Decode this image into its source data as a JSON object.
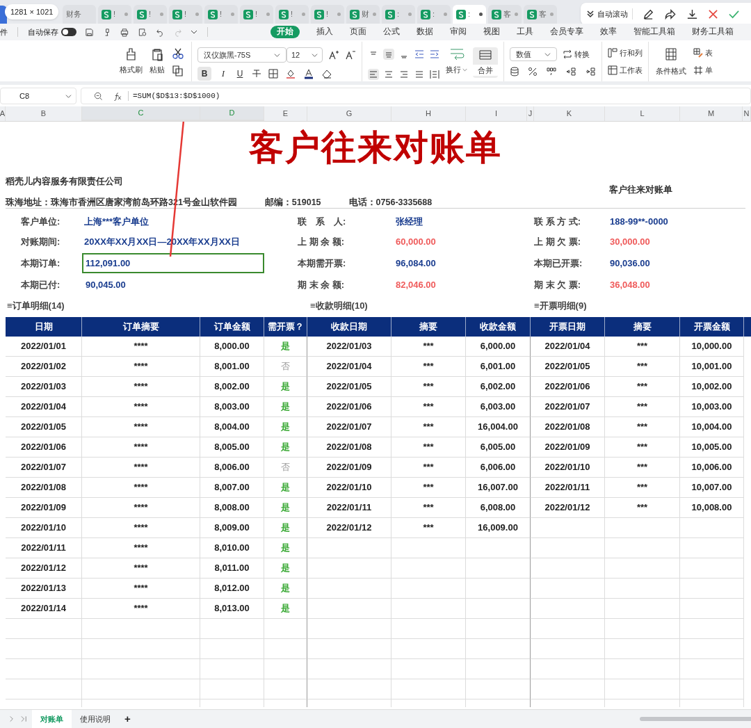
{
  "browser_tabs": {
    "size_tooltip": "1281 × 1021",
    "tabs": [
      {
        "label": "财务",
        "kind": "plain",
        "selected": false
      },
      {
        "label": "!",
        "kind": "sheet",
        "selected": false
      },
      {
        "label": "!",
        "kind": "sheet",
        "selected": false
      },
      {
        "label": "!",
        "kind": "sheet",
        "selected": false
      },
      {
        "label": "!",
        "kind": "sheet",
        "selected": false
      },
      {
        "label": "!",
        "kind": "sheet",
        "selected": false
      },
      {
        "label": "!",
        "kind": "sheet",
        "selected": false
      },
      {
        "label": "!",
        "kind": "sheet",
        "selected": false
      },
      {
        "label": "财",
        "kind": "sheet",
        "selected": false
      },
      {
        "label": ":",
        "kind": "sheet",
        "selected": false
      },
      {
        "label": ":",
        "kind": "sheet",
        "selected": false
      },
      {
        "label": ":",
        "kind": "sheet",
        "selected": true
      },
      {
        "label": "客",
        "kind": "sheet",
        "selected": false
      },
      {
        "label": "客",
        "kind": "sheet",
        "selected": false
      }
    ]
  },
  "float_toolbar": {
    "auto_scroll": "自动滚动"
  },
  "menu": {
    "file": "件",
    "autosave": "自动保存",
    "autosave_on": false,
    "tabs": [
      {
        "label": "开始",
        "selected": true
      },
      {
        "label": "插入",
        "selected": false
      },
      {
        "label": "页面",
        "selected": false
      },
      {
        "label": "公式",
        "selected": false
      },
      {
        "label": "数据",
        "selected": false
      },
      {
        "label": "审阅",
        "selected": false
      },
      {
        "label": "视图",
        "selected": false
      },
      {
        "label": "工具",
        "selected": false
      },
      {
        "label": "会员专享",
        "selected": false
      },
      {
        "label": "效率",
        "selected": false
      },
      {
        "label": "智能工具箱",
        "selected": false
      },
      {
        "label": "财务工具箱",
        "selected": false
      }
    ]
  },
  "ribbon": {
    "format_painter": "格式刷",
    "paste": "粘贴",
    "font": "汉仪旗黑-75S",
    "size": "12",
    "bold": "B",
    "italic": "I",
    "underline": "U",
    "wrap": "换行",
    "merge": "合并",
    "number_format": "数值",
    "convert": "转换",
    "rows_cols": "行和列",
    "worksheet": "工作表",
    "conditional": "条件格式",
    "table_cut": "表",
    "cell_cut": "单"
  },
  "formula_bar": {
    "cell": "C8",
    "formula": "=SUM($D$13:$D$1000)"
  },
  "column_headers": [
    {
      "label": "A",
      "selected": false
    },
    {
      "label": "B",
      "selected": false
    },
    {
      "label": "C",
      "selected": true
    },
    {
      "label": "D",
      "selected": true
    },
    {
      "label": "E",
      "selected": false
    },
    {
      "label": "G",
      "selected": false
    },
    {
      "label": "H",
      "selected": false
    },
    {
      "label": "I",
      "selected": false
    },
    {
      "label": "J",
      "selected": false
    },
    {
      "label": "K",
      "selected": false
    },
    {
      "label": "L",
      "selected": false
    },
    {
      "label": "M",
      "selected": false
    },
    {
      "label": "N",
      "selected": false
    }
  ],
  "sheet": {
    "title": "客户往来对账单",
    "company": "稻壳儿内容服务有限责任公司",
    "address": "珠海地址：珠海市香洲区唐家湾前岛环路321号金山软件园",
    "postcode": "邮编：519015",
    "phone": "电话：0756-3335688",
    "doc_name": "客户往来对账单",
    "info": [
      [
        {
          "label": "客户单位:",
          "value": "上海***客户单位",
          "color": "#1a3d8f"
        },
        {
          "label": "联　系　人:",
          "value": "张经理",
          "color": "#1a3d8f"
        },
        {
          "label": "联 系 方 式:",
          "value": "188-99**-0000",
          "color": "#1a3d8f"
        }
      ],
      [
        {
          "label": "对账期间:",
          "value": "20XX年XX月XX日—20XX年XX月XX日",
          "color": "#1a3d8f"
        },
        {
          "label": "上 期 余 额:",
          "value": "60,000.00",
          "color": "#ef5b5b"
        },
        {
          "label": "上 期 欠 票:",
          "value": "30,000.00",
          "color": "#ef5b5b"
        }
      ],
      [
        {
          "label": "本期订单:",
          "value": "112,091.00",
          "color": "#1a3d8f",
          "selected": true
        },
        {
          "label": "本期需开票:",
          "value": "96,084.00",
          "color": "#1a3d8f"
        },
        {
          "label": "本期已开票:",
          "value": "90,036.00",
          "color": "#1a3d8f"
        }
      ],
      [
        {
          "label": "本期已付:",
          "value": "90,045.00",
          "color": "#1a3d8f",
          "selected": false
        },
        {
          "label": "期 末 余 额:",
          "value": "82,046.00",
          "color": "#ef5b5b"
        },
        {
          "label": "期 末 欠 票:",
          "value": "36,048.00",
          "color": "#ef5b5b"
        }
      ]
    ],
    "sections": [
      "≡订单明细(14)",
      "≡收款明细(10)",
      "≡开票明细(9)"
    ],
    "columns": [
      "日期",
      "订单摘要",
      "订单金额",
      "需开票？",
      "收款日期",
      "摘要",
      "收款金额",
      "开票日期",
      "摘要",
      "开票金额"
    ],
    "orders": [
      {
        "date": "2022/01/01",
        "summary": "****",
        "amount": "8,000.00",
        "invoice": "是",
        "needs_invoice": true
      },
      {
        "date": "2022/01/02",
        "summary": "****",
        "amount": "8,001.00",
        "invoice": "否",
        "needs_invoice": false
      },
      {
        "date": "2022/01/03",
        "summary": "****",
        "amount": "8,002.00",
        "invoice": "是",
        "needs_invoice": true
      },
      {
        "date": "2022/01/04",
        "summary": "****",
        "amount": "8,003.00",
        "invoice": "是",
        "needs_invoice": true
      },
      {
        "date": "2022/01/05",
        "summary": "****",
        "amount": "8,004.00",
        "invoice": "是",
        "needs_invoice": true
      },
      {
        "date": "2022/01/06",
        "summary": "****",
        "amount": "8,005.00",
        "invoice": "是",
        "needs_invoice": true
      },
      {
        "date": "2022/01/07",
        "summary": "****",
        "amount": "8,006.00",
        "invoice": "否",
        "needs_invoice": false
      },
      {
        "date": "2022/01/08",
        "summary": "****",
        "amount": "8,007.00",
        "invoice": "是",
        "needs_invoice": true
      },
      {
        "date": "2022/01/09",
        "summary": "****",
        "amount": "8,008.00",
        "invoice": "是",
        "needs_invoice": true
      },
      {
        "date": "2022/01/10",
        "summary": "****",
        "amount": "8,009.00",
        "invoice": "是",
        "needs_invoice": true
      },
      {
        "date": "2022/01/11",
        "summary": "****",
        "amount": "8,010.00",
        "invoice": "是",
        "needs_invoice": true
      },
      {
        "date": "2022/01/12",
        "summary": "****",
        "amount": "8,011.00",
        "invoice": "是",
        "needs_invoice": true
      },
      {
        "date": "2022/01/13",
        "summary": "****",
        "amount": "8,012.00",
        "invoice": "是",
        "needs_invoice": true
      },
      {
        "date": "2022/01/14",
        "summary": "****",
        "amount": "8,013.00",
        "invoice": "是",
        "needs_invoice": true
      }
    ],
    "receipts": [
      {
        "date": "2022/01/03",
        "summary": "***",
        "amount": "6,000.00"
      },
      {
        "date": "2022/01/04",
        "summary": "***",
        "amount": "6,001.00"
      },
      {
        "date": "2022/01/05",
        "summary": "***",
        "amount": "6,002.00"
      },
      {
        "date": "2022/01/06",
        "summary": "***",
        "amount": "6,003.00"
      },
      {
        "date": "2022/01/07",
        "summary": "***",
        "amount": "16,004.00"
      },
      {
        "date": "2022/01/08",
        "summary": "***",
        "amount": "6,005.00"
      },
      {
        "date": "2022/01/09",
        "summary": "***",
        "amount": "6,006.00"
      },
      {
        "date": "2022/01/10",
        "summary": "***",
        "amount": "16,007.00"
      },
      {
        "date": "2022/01/11",
        "summary": "***",
        "amount": "6,008.00"
      },
      {
        "date": "2022/01/12",
        "summary": "***",
        "amount": "16,009.00"
      }
    ],
    "invoices": [
      {
        "date": "2022/01/04",
        "summary": "***",
        "amount": "10,000.00"
      },
      {
        "date": "2022/01/05",
        "summary": "***",
        "amount": "10,001.00"
      },
      {
        "date": "2022/01/06",
        "summary": "***",
        "amount": "10,002.00"
      },
      {
        "date": "2022/01/07",
        "summary": "***",
        "amount": "10,003.00"
      },
      {
        "date": "2022/01/08",
        "summary": "***",
        "amount": "10,004.00"
      },
      {
        "date": "2022/01/09",
        "summary": "***",
        "amount": "10,005.00"
      },
      {
        "date": "2022/01/10",
        "summary": "***",
        "amount": "10,006.00"
      },
      {
        "date": "2022/01/11",
        "summary": "***",
        "amount": "10,007.00"
      },
      {
        "date": "2022/01/12",
        "summary": "***",
        "amount": "10,008.00"
      }
    ]
  },
  "sheet_tabs": [
    {
      "label": "对账单",
      "selected": true
    },
    {
      "label": "使用说明",
      "selected": false
    }
  ],
  "add_sheet": "+"
}
